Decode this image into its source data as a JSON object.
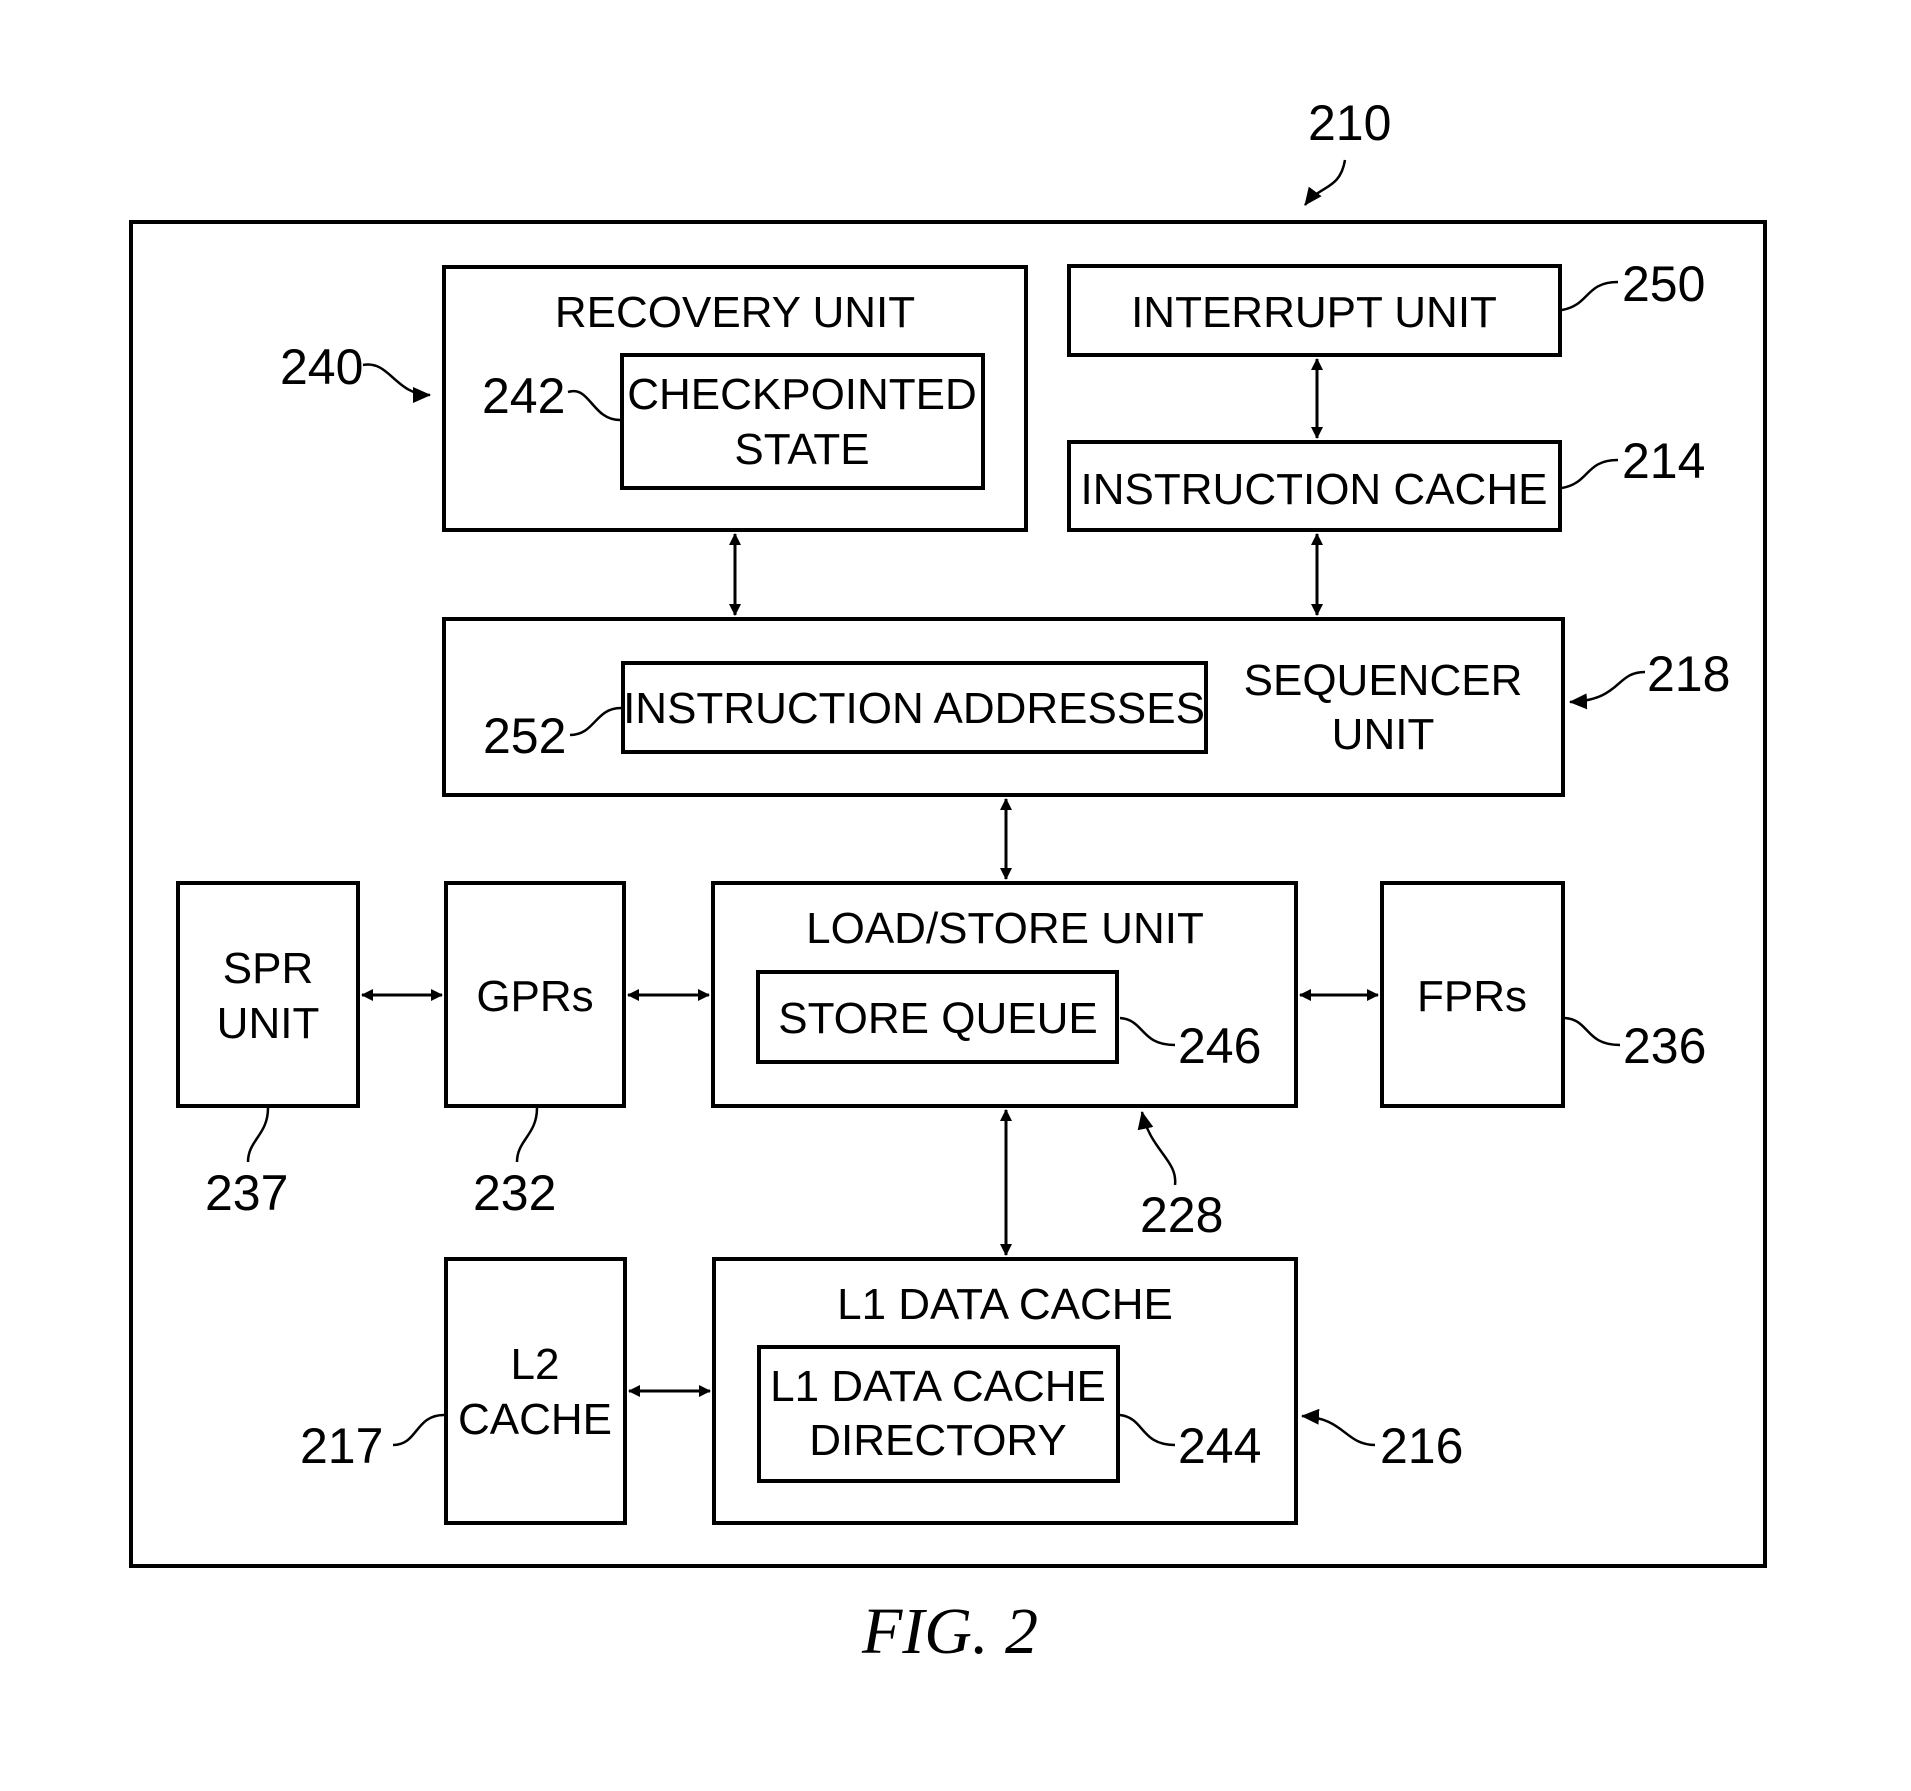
{
  "figure": {
    "caption": "FIG. 2",
    "system_ref": "210"
  },
  "blocks": {
    "recovery_unit": {
      "label": "RECOVERY UNIT",
      "ref": "240"
    },
    "checkpointed_state": {
      "line1": "CHECKPOINTED",
      "line2": "STATE",
      "ref": "242"
    },
    "interrupt_unit": {
      "label": "INTERRUPT UNIT",
      "ref": "250"
    },
    "instruction_cache": {
      "label": "INSTRUCTION CACHE",
      "ref": "214"
    },
    "sequencer_unit": {
      "line1": "SEQUENCER",
      "line2": "UNIT",
      "ref": "218"
    },
    "instruction_addresses": {
      "label": "INSTRUCTION ADDRESSES",
      "ref": "252"
    },
    "spr_unit": {
      "line1": "SPR",
      "line2": "UNIT",
      "ref": "237"
    },
    "gprs": {
      "label": "GPRs",
      "ref": "232"
    },
    "load_store_unit": {
      "label": "LOAD/STORE UNIT",
      "ref": "228"
    },
    "store_queue": {
      "label": "STORE QUEUE",
      "ref": "246"
    },
    "fprs": {
      "label": "FPRs",
      "ref": "236"
    },
    "l2_cache": {
      "line1": "L2",
      "line2": "CACHE",
      "ref": "217"
    },
    "l1_data_cache": {
      "label": "L1 DATA CACHE",
      "ref": "216"
    },
    "l1_directory": {
      "line1": "L1 DATA CACHE",
      "line2": "DIRECTORY",
      "ref": "244"
    }
  },
  "connections": [
    {
      "from": "recovery_unit",
      "to": "sequencer_unit",
      "type": "bidirectional"
    },
    {
      "from": "interrupt_unit",
      "to": "instruction_cache",
      "type": "bidirectional"
    },
    {
      "from": "instruction_cache",
      "to": "sequencer_unit",
      "type": "bidirectional"
    },
    {
      "from": "sequencer_unit",
      "to": "load_store_unit",
      "type": "bidirectional"
    },
    {
      "from": "spr_unit",
      "to": "gprs",
      "type": "bidirectional"
    },
    {
      "from": "gprs",
      "to": "load_store_unit",
      "type": "bidirectional"
    },
    {
      "from": "load_store_unit",
      "to": "fprs",
      "type": "bidirectional"
    },
    {
      "from": "load_store_unit",
      "to": "l1_data_cache",
      "type": "bidirectional"
    },
    {
      "from": "l2_cache",
      "to": "l1_data_cache",
      "type": "bidirectional"
    }
  ]
}
